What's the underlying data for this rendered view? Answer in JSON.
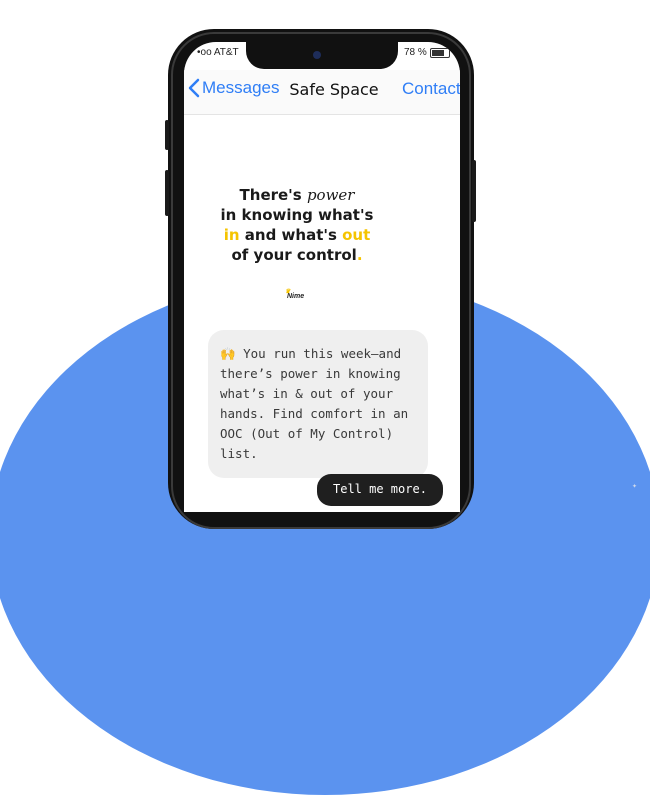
{
  "status_bar": {
    "carrier": "•oo AT&T",
    "battery": "78 %"
  },
  "navbar": {
    "back_label": "Messages",
    "title": "Safe Space",
    "contact_label": "Contact"
  },
  "quote_image": {
    "line1_prefix": "There's ",
    "line1_italic": "power",
    "line2": "in knowing what's",
    "line3_in": "in",
    "line3_mid": " and what's ",
    "line3_out": "out",
    "line4": "of your control",
    "line4_dot": ".",
    "logo_text": "Nime"
  },
  "messages": {
    "received": "🙌 You run this week—and there’s power in knowing what’s in & out of your hands. Find comfort in an OOC (Out of My Control) list.",
    "sent": "Tell me more."
  },
  "colors": {
    "accent_blue": "#2f7ef6",
    "blob_blue": "#5b93ef",
    "highlight_yellow": "#f5c400"
  }
}
